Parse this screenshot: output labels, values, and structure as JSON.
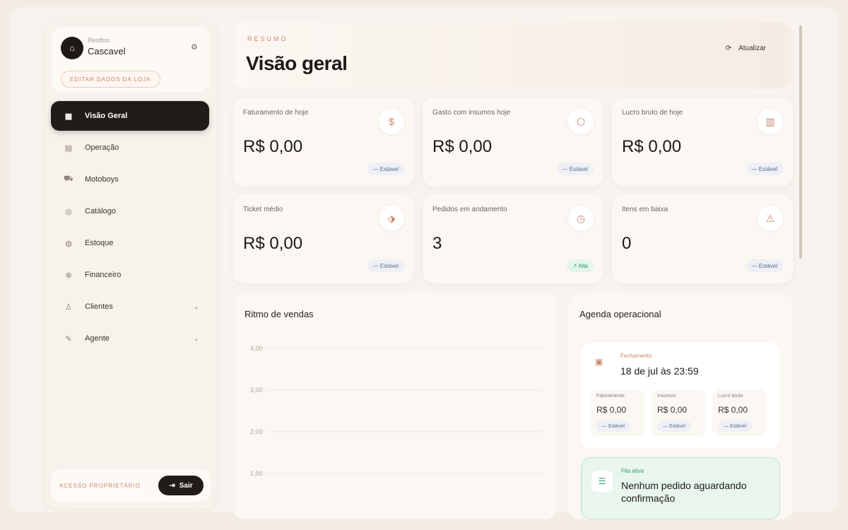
{
  "store": {
    "eyebrow": "Restfoo",
    "name": "Cascavel",
    "avatar_icon": "store-icon",
    "edit_label": "EDITAR DADOS DA LOJA"
  },
  "nav": {
    "items": [
      {
        "label": "Visão Geral",
        "icon": "dashboard-icon",
        "active": true
      },
      {
        "label": "Operação",
        "icon": "grid-icon"
      },
      {
        "label": "Motoboys",
        "icon": "motorbike-icon"
      },
      {
        "label": "Catálogo",
        "icon": "catalog-icon"
      },
      {
        "label": "Estoque",
        "icon": "box-icon"
      },
      {
        "label": "Financeiro",
        "icon": "finance-icon"
      },
      {
        "label": "Clientes",
        "icon": "users-icon",
        "expandable": true
      },
      {
        "label": "Agente",
        "icon": "agent-icon",
        "expandable": true
      }
    ]
  },
  "footer": {
    "label": "ACESSO PROPRIETÁRIO",
    "logout_label": "Sair"
  },
  "header": {
    "eyebrow": "RESUMO",
    "title": "Visão geral",
    "refresh_label": "Atualizar"
  },
  "stats": [
    {
      "label": "Faturamento de hoje",
      "value": "R$ 0,00",
      "badge": "— Estável",
      "icon": "dollar-icon"
    },
    {
      "label": "Gasto com insumos hoje",
      "value": "R$ 0,00",
      "badge": "— Estável",
      "icon": "package-icon"
    },
    {
      "label": "Lucro bruto de hoje",
      "value": "R$ 0,00",
      "badge": "— Estável",
      "icon": "receipt-icon"
    },
    {
      "label": "Ticket médio",
      "value": "R$ 0,00",
      "badge": "— Estável",
      "icon": "tag-icon"
    },
    {
      "label": "Pedidos em andamento",
      "value": "3",
      "badge": "↗ Alta",
      "icon": "clock-icon"
    },
    {
      "label": "Itens em baixa",
      "value": "0",
      "badge": "— Estável",
      "icon": "alert-icon"
    }
  ],
  "chart": {
    "title": "Ritmo de vendas"
  },
  "chart_data": {
    "type": "line",
    "title": "Ritmo de vendas",
    "y_ticks": [
      "4,00",
      "3,00",
      "2,00",
      "1,00"
    ],
    "ylim": [
      0,
      4
    ],
    "grid": true,
    "series": []
  },
  "agenda": {
    "title": "Agenda operacional",
    "closing": {
      "eyebrow": "Fechamento",
      "time": "18 de jul às 23:59",
      "cards": [
        {
          "label": "Faturamento",
          "value": "R$ 0,00",
          "badge": "— Estável"
        },
        {
          "label": "Insumos",
          "value": "R$ 0,00",
          "badge": "— Estável"
        },
        {
          "label": "Lucro bruto",
          "value": "R$ 0,00",
          "badge": "— Estável"
        }
      ]
    },
    "queue": {
      "eyebrow": "Fila ativa",
      "text": "Nenhum pedido aguardando confirmação"
    }
  },
  "colors": {
    "accent": "#c9876a",
    "dark": "#221c18",
    "success": "#2f9a63",
    "background": "#f3ece4"
  }
}
